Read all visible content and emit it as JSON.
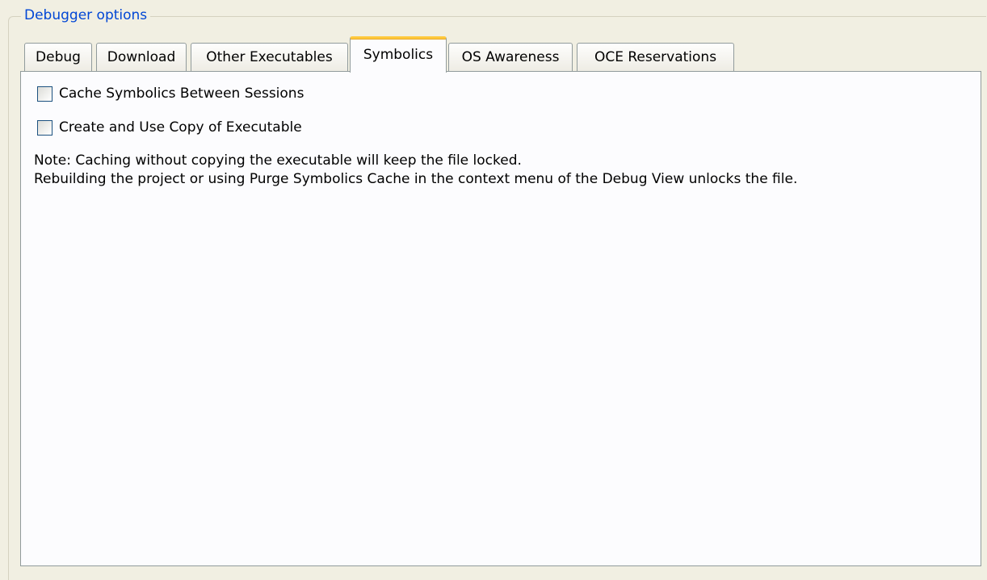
{
  "group_box": {
    "title": "Debugger options"
  },
  "tabs": [
    {
      "label": "Debug",
      "active": false
    },
    {
      "label": "Download",
      "active": false
    },
    {
      "label": "Other Executables",
      "active": false
    },
    {
      "label": "Symbolics",
      "active": true
    },
    {
      "label": "OS Awareness",
      "active": false
    },
    {
      "label": "OCE Reservations",
      "active": false
    }
  ],
  "symbolics_panel": {
    "checkboxes": [
      {
        "label": "Cache Symbolics Between Sessions",
        "checked": false
      },
      {
        "label": "Create and Use Copy of Executable",
        "checked": false
      }
    ],
    "note_lines": [
      "Note: Caching without copying the executable will keep the file locked.",
      "Rebuilding the project or using Purge Symbolics Cache in the context menu of the Debug View unlocks the file."
    ]
  },
  "colors": {
    "background": "#f1efe2",
    "group_title": "#0046d5",
    "panel": "#fcfcfe",
    "active_tab_accent": "#ffc83c",
    "border": "#919b9c"
  }
}
